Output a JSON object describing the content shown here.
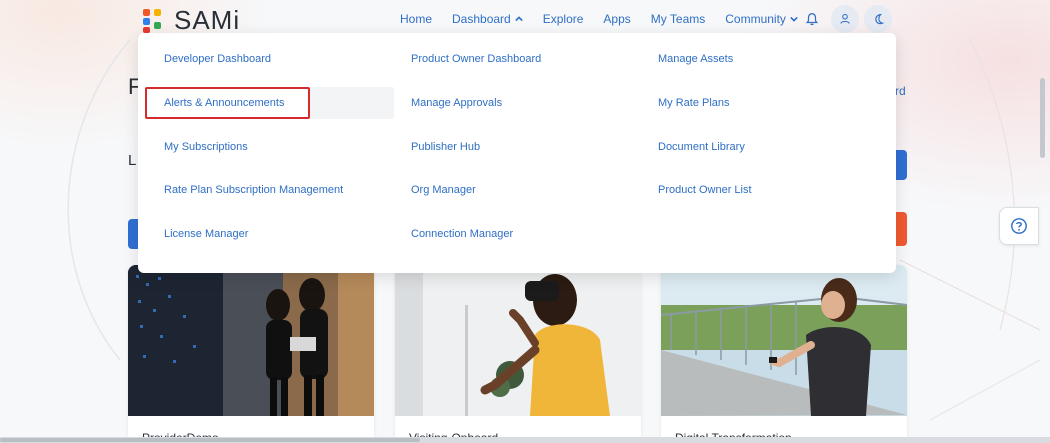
{
  "brand": {
    "name": "SAMi"
  },
  "nav": {
    "items": [
      "Home",
      "Dashboard",
      "Explore",
      "Apps",
      "My Teams",
      "Community"
    ]
  },
  "page": {
    "title_fragment": "F",
    "subtitle_fragment": "L",
    "right_link_fragment": "rd"
  },
  "dropdown": {
    "items": [
      "Developer Dashboard",
      "Alerts & Announcements",
      "My Subscriptions",
      "Rate Plan Subscription Management",
      "License Manager",
      "Product Owner Dashboard",
      "Manage Approvals",
      "Publisher Hub",
      "Org Manager",
      "Connection Manager",
      "Manage Assets",
      "My Rate Plans",
      "Document Library",
      "Product Owner List"
    ],
    "highlighted": "Alerts & Announcements"
  },
  "cards": [
    {
      "title": "ProviderDemo"
    },
    {
      "title": "Visiting-Onboard"
    },
    {
      "title": "Digital Transformation"
    }
  ],
  "colors": {
    "link": "#2f6fc4",
    "primary_button": "#2f6fd4",
    "danger_button": "#f15a32",
    "highlight_border": "#d52b2b"
  },
  "icons": [
    "bell-icon",
    "user-icon",
    "moon-icon",
    "help-icon",
    "chevron-up-icon",
    "chevron-down-icon"
  ]
}
